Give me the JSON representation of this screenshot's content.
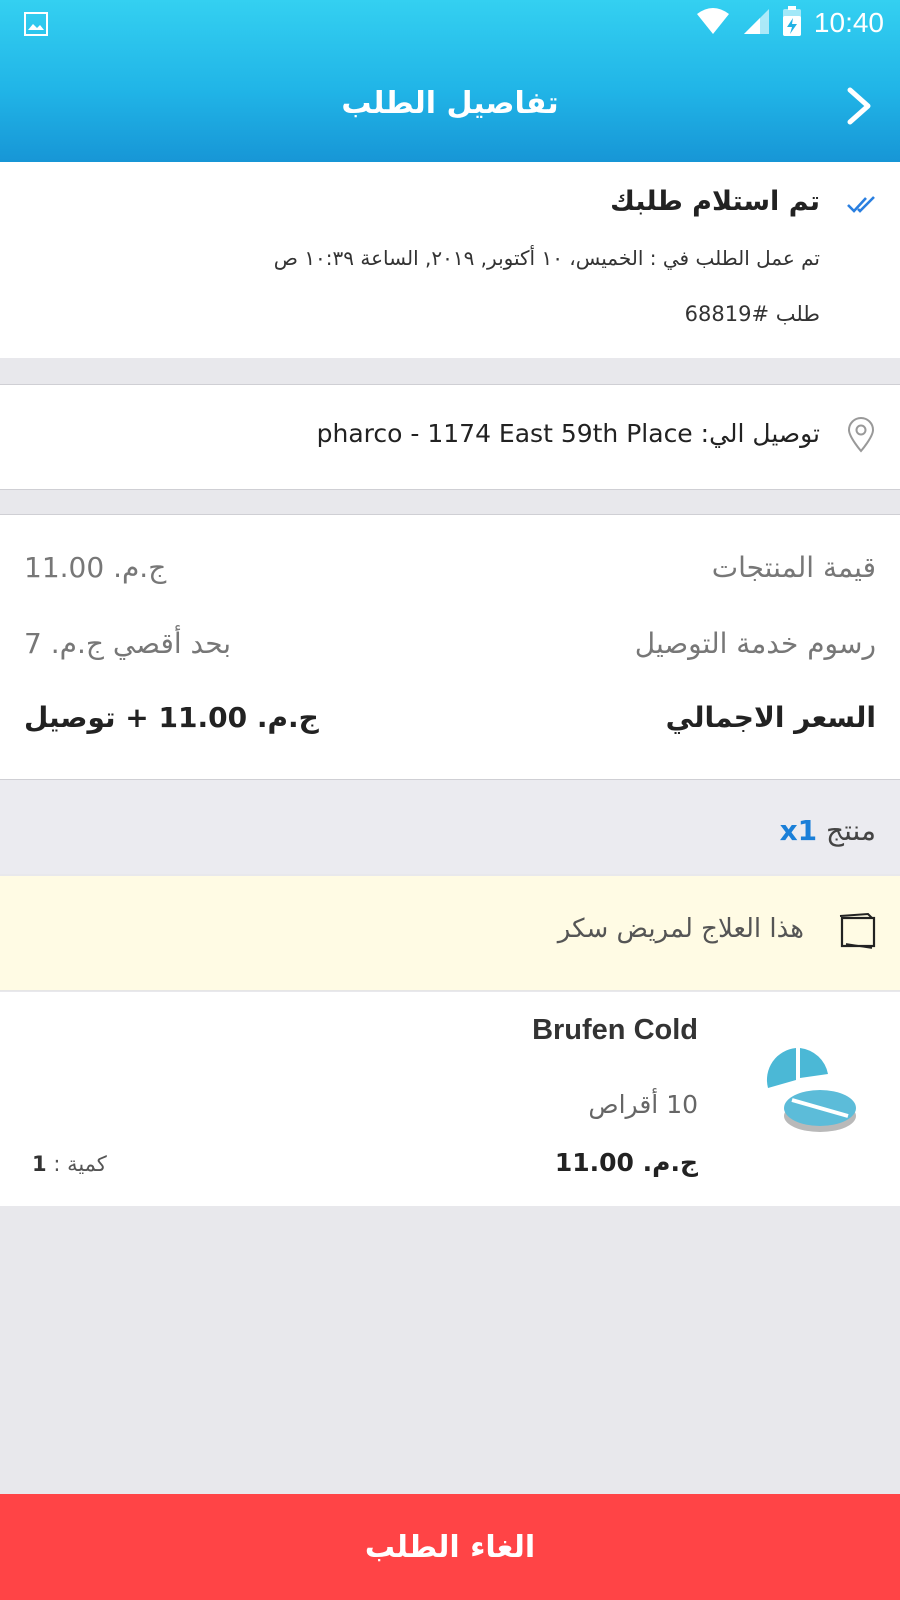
{
  "status_bar": {
    "time": "10:40"
  },
  "header": {
    "title": "تفاصيل الطلب"
  },
  "order_status": {
    "title": "تم استلام طلبك",
    "date_line": "تم عمل الطلب في : الخميس، ١٠ أكتوبر, ٢٠١٩, الساعة ١٠:٣٩ ص",
    "order_number": "طلب #68819"
  },
  "delivery": {
    "label": "توصيل الي: pharco - 1174 East 59th Place"
  },
  "pricing": {
    "products_label": "قيمة المنتجات",
    "products_value": "ج.م. 11.00",
    "delivery_label": "رسوم خدمة التوصيل",
    "delivery_value": "بحد أقصي ج.م. 7",
    "total_label": "السعر الاجمالي",
    "total_value": "ج.م. 11.00 + توصيل"
  },
  "items_summary": {
    "label": "منتج",
    "count": "x1"
  },
  "note": {
    "text": "هذا العلاج لمريض سكر"
  },
  "product": {
    "name": "Brufen Cold",
    "package": "10 أقراص",
    "price": "ج.م. 11.00",
    "qty_label": "كمية :",
    "qty_value": "1"
  },
  "actions": {
    "cancel_label": "الغاء الطلب"
  },
  "colors": {
    "header_gradient_top": "#34d0f1",
    "header_gradient_bottom": "#1796d6",
    "cancel_button": "#ff4446",
    "accent_blue": "#1a7fd8",
    "note_background": "#fffbe4"
  }
}
